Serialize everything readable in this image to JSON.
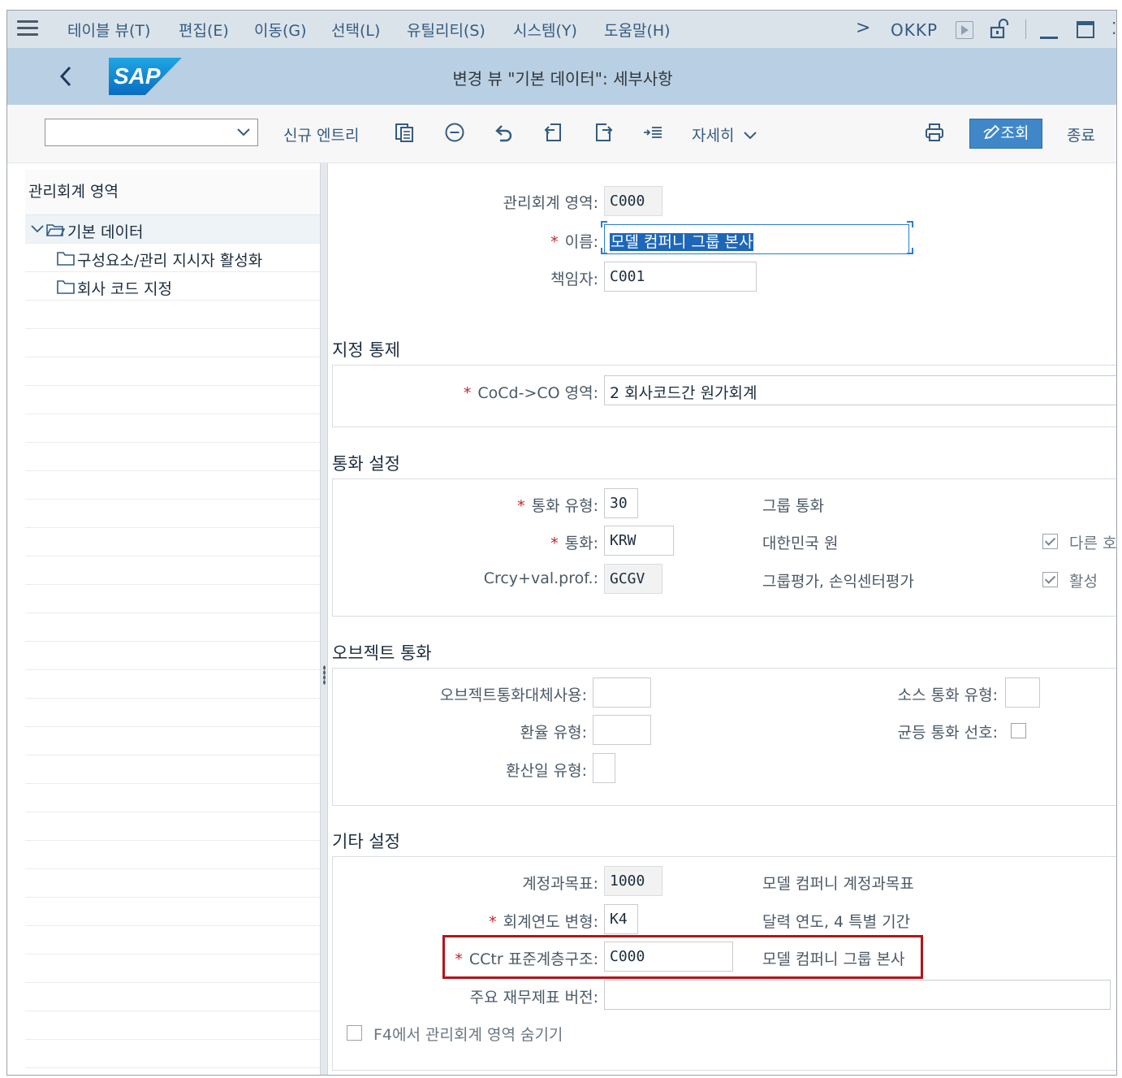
{
  "menubar": {
    "items": [
      "테이블 뷰(T)",
      "편집(E)",
      "이동(G)",
      "선택(L)",
      "유틸리티(S)",
      "시스템(Y)",
      "도움말(H)"
    ],
    "transaction": "OKKP",
    "nav_chevron": ">"
  },
  "titlebar": {
    "logo_text": "SAP",
    "title": "변경 뷰 \"기본 데이터\": 세부사항"
  },
  "toolbar": {
    "dropdown_value": "",
    "new_entries": "신규 엔트리",
    "more": "자세히",
    "display": "조회",
    "exit": "종료"
  },
  "tree": {
    "header": "관리회계 영역",
    "items": [
      {
        "label": "기본 데이터",
        "expanded": true,
        "selected": true
      },
      {
        "label": "구성요소/관리 지시자 활성화"
      },
      {
        "label": "회사 코드 지정"
      }
    ]
  },
  "header_fields": {
    "co_area_label": "관리회계 영역:",
    "co_area_value": "C000",
    "name_label": "이름:",
    "name_value": "모델 컴퍼니 그룹 본사",
    "person_label": "책임자:",
    "person_value": "C001"
  },
  "assignment": {
    "title": "지정 통제",
    "cocd_label": "CoCd->CO 영역:",
    "cocd_value": "2 회사코드간 원가회계"
  },
  "currency": {
    "title": "통화 설정",
    "type_label": "통화 유형:",
    "type_value": "30",
    "type_desc": "그룹 통화",
    "currency_label": "통화:",
    "currency_value": "KRW",
    "currency_desc": "대한민국 원",
    "profile_label": "Crcy+val.prof.:",
    "profile_value": "GCGV",
    "profile_desc": "그룹평가, 손익센터평가",
    "diff_currency_label": "다른 호",
    "active_label": "활성"
  },
  "object_currency": {
    "title": "오브젝트 통화",
    "alt_label": "오브젝트통화대체사용:",
    "alt_value": "",
    "rate_label": "환율 유형:",
    "rate_value": "",
    "trans_date_label": "환산일 유형:",
    "trans_date_value": "",
    "source_label": "소스 통화 유형:",
    "source_value": "",
    "uniform_label": "균등 통화 선호:"
  },
  "other": {
    "title": "기타 설정",
    "coa_label": "계정과목표:",
    "coa_value": "1000",
    "coa_desc": "모델 컴퍼니 계정과목표",
    "fy_label": "회계연도 변형:",
    "fy_value": "K4",
    "fy_desc": "달력 연도, 4 특별 기간",
    "std_hier_label": "CCtr 표준계층구조:",
    "std_hier_value": "C000",
    "std_hier_desc": "모델 컴퍼니 그룹 본사",
    "fin_version_label": "주요 재무제표 버전:",
    "fin_version_value": "",
    "hide_label": "F4에서 관리회계 영역 숨기기"
  },
  "colors": {
    "menubar": "#dbe3ea",
    "titlebar": "#b9d0e4",
    "accent": "#3f87c9",
    "highlight_box": "#b5131a",
    "required": "#c4242b"
  }
}
